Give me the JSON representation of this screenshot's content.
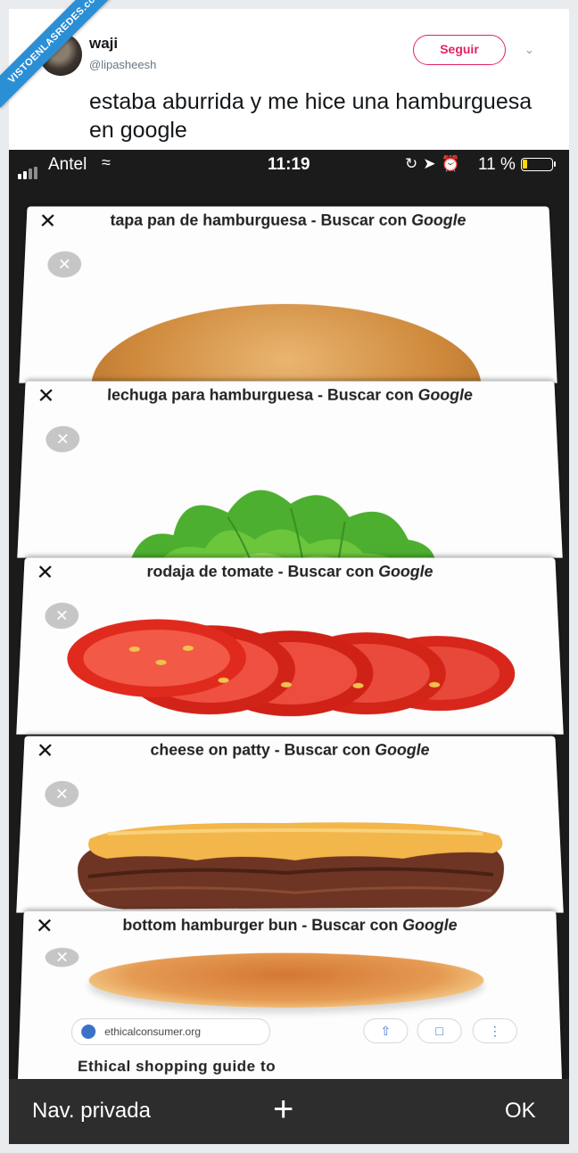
{
  "watermark": "VISTOENLASREDES.com",
  "tweet": {
    "name": "waji",
    "handle": "@lipasheesh",
    "follow_label": "Seguir",
    "text": "estaba aburrida y me hice una hamburguesa en google"
  },
  "status_bar": {
    "carrier": "Antel",
    "time": "11:19",
    "battery": "11 %",
    "icons": [
      "lock-rotation-icon",
      "location-icon",
      "alarm-icon"
    ]
  },
  "tabs": [
    {
      "title_prefix": "tapa pan de hamburguesa - Buscar con ",
      "title_brand": "Google",
      "food": "top-bun"
    },
    {
      "title_prefix": "lechuga para hamburguesa - Buscar con ",
      "title_brand": "Google",
      "food": "lettuce"
    },
    {
      "title_prefix": "rodaja de tomate - Buscar con ",
      "title_brand": "Google",
      "food": "tomato-slices"
    },
    {
      "title_prefix": "cheese on patty - Buscar con ",
      "title_brand": "Google",
      "food": "cheese-patty"
    },
    {
      "title_prefix": "bottom hamburger bun - Buscar con ",
      "title_brand": "Google",
      "food": "bottom-bun",
      "result_url": "ethicalconsumer.org",
      "result_snippet": "Ethical shopping guide to"
    }
  ],
  "bottom_bar": {
    "private_label": "Nav. privada",
    "add_label": "+",
    "done_label": "OK"
  },
  "colors": {
    "follow": "#e0245e",
    "phone_bg": "#1b1b1b",
    "battery_low": "#ffd60a"
  }
}
